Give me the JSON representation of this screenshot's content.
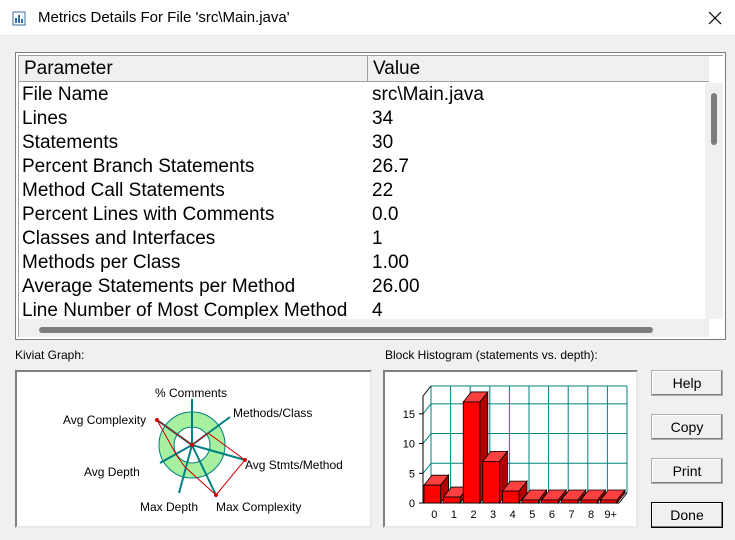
{
  "window": {
    "title": "Metrics Details For File 'src\\Main.java'"
  },
  "table": {
    "headers": [
      "Parameter",
      "Value"
    ],
    "rows": [
      {
        "parameter": "File Name",
        "value": "src\\Main.java"
      },
      {
        "parameter": "Lines",
        "value": "34"
      },
      {
        "parameter": "Statements",
        "value": "30"
      },
      {
        "parameter": "Percent Branch Statements",
        "value": "26.7"
      },
      {
        "parameter": "Method Call Statements",
        "value": "22"
      },
      {
        "parameter": "Percent Lines with Comments",
        "value": "0.0"
      },
      {
        "parameter": "Classes and Interfaces",
        "value": "1"
      },
      {
        "parameter": "Methods per Class",
        "value": "1.00"
      },
      {
        "parameter": "Average Statements per Method",
        "value": "26.00"
      },
      {
        "parameter": "Line Number of Most Complex Method",
        "value": "4"
      }
    ]
  },
  "kiviat": {
    "label": "Kiviat Graph:",
    "axes": [
      "% Comments",
      "Methods/Class",
      "Avg Stmts/Method",
      "Max Complexity",
      "Max Depth",
      "Avg Depth",
      "Avg Complexity"
    ]
  },
  "histogram": {
    "label": "Block Histogram (statements vs. depth):"
  },
  "chart_data": {
    "type": "bar",
    "title": "Block Histogram (statements vs. depth):",
    "categories": [
      "0",
      "1",
      "2",
      "3",
      "4",
      "5",
      "6",
      "7",
      "8",
      "9+"
    ],
    "values": [
      3,
      1,
      17,
      7,
      2,
      0,
      0,
      0,
      0,
      0
    ],
    "yticks": [
      "0",
      "5",
      "10",
      "15"
    ],
    "ylim": [
      0,
      18
    ],
    "grid": true,
    "bar_color": "#ff0000"
  },
  "buttons": {
    "help": "Help",
    "copy": "Copy",
    "print": "Print",
    "done": "Done"
  },
  "colors": {
    "kiviat_band": "#a6f0a0",
    "kiviat_line": "#d00000",
    "axis_line": "#008080",
    "bar": "#ff0000"
  }
}
